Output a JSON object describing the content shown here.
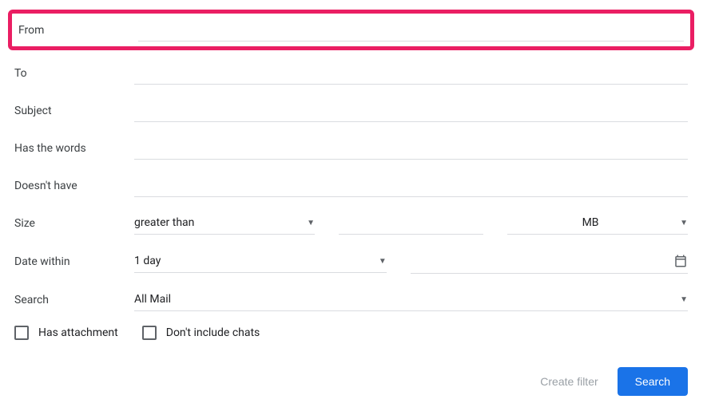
{
  "fields": {
    "from": {
      "label": "From",
      "value": ""
    },
    "to": {
      "label": "To",
      "value": ""
    },
    "subject": {
      "label": "Subject",
      "value": ""
    },
    "words": {
      "label": "Has the words",
      "value": ""
    },
    "nothave": {
      "label": "Doesn't have",
      "value": ""
    }
  },
  "size": {
    "label": "Size",
    "comparator": "greater than",
    "value": "",
    "unit": "MB"
  },
  "date": {
    "label": "Date within",
    "range": "1 day",
    "value": ""
  },
  "searchIn": {
    "label": "Search",
    "value": "All Mail"
  },
  "checkboxes": {
    "hasAttachment": {
      "label": "Has attachment",
      "checked": false
    },
    "excludeChats": {
      "label": "Don't include chats",
      "checked": false
    }
  },
  "actions": {
    "createFilter": "Create filter",
    "search": "Search"
  }
}
